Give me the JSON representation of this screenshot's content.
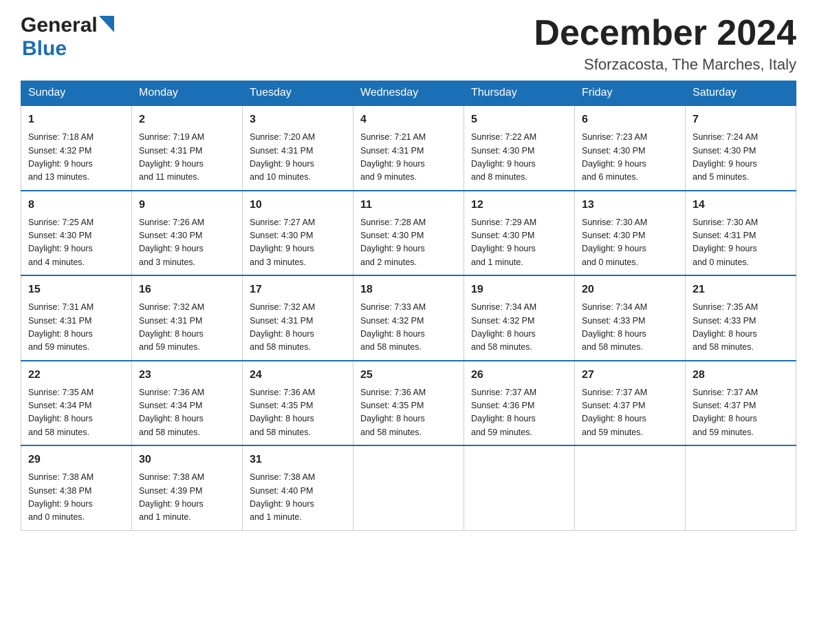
{
  "header": {
    "logo_general": "General",
    "logo_blue": "Blue",
    "month_title": "December 2024",
    "location": "Sforzacosta, The Marches, Italy"
  },
  "days_of_week": [
    "Sunday",
    "Monday",
    "Tuesday",
    "Wednesday",
    "Thursday",
    "Friday",
    "Saturday"
  ],
  "weeks": [
    [
      {
        "day": "1",
        "sunrise": "7:18 AM",
        "sunset": "4:32 PM",
        "daylight": "9 hours and 13 minutes."
      },
      {
        "day": "2",
        "sunrise": "7:19 AM",
        "sunset": "4:31 PM",
        "daylight": "9 hours and 11 minutes."
      },
      {
        "day": "3",
        "sunrise": "7:20 AM",
        "sunset": "4:31 PM",
        "daylight": "9 hours and 10 minutes."
      },
      {
        "day": "4",
        "sunrise": "7:21 AM",
        "sunset": "4:31 PM",
        "daylight": "9 hours and 9 minutes."
      },
      {
        "day": "5",
        "sunrise": "7:22 AM",
        "sunset": "4:30 PM",
        "daylight": "9 hours and 8 minutes."
      },
      {
        "day": "6",
        "sunrise": "7:23 AM",
        "sunset": "4:30 PM",
        "daylight": "9 hours and 6 minutes."
      },
      {
        "day": "7",
        "sunrise": "7:24 AM",
        "sunset": "4:30 PM",
        "daylight": "9 hours and 5 minutes."
      }
    ],
    [
      {
        "day": "8",
        "sunrise": "7:25 AM",
        "sunset": "4:30 PM",
        "daylight": "9 hours and 4 minutes."
      },
      {
        "day": "9",
        "sunrise": "7:26 AM",
        "sunset": "4:30 PM",
        "daylight": "9 hours and 3 minutes."
      },
      {
        "day": "10",
        "sunrise": "7:27 AM",
        "sunset": "4:30 PM",
        "daylight": "9 hours and 3 minutes."
      },
      {
        "day": "11",
        "sunrise": "7:28 AM",
        "sunset": "4:30 PM",
        "daylight": "9 hours and 2 minutes."
      },
      {
        "day": "12",
        "sunrise": "7:29 AM",
        "sunset": "4:30 PM",
        "daylight": "9 hours and 1 minute."
      },
      {
        "day": "13",
        "sunrise": "7:30 AM",
        "sunset": "4:30 PM",
        "daylight": "9 hours and 0 minutes."
      },
      {
        "day": "14",
        "sunrise": "7:30 AM",
        "sunset": "4:31 PM",
        "daylight": "9 hours and 0 minutes."
      }
    ],
    [
      {
        "day": "15",
        "sunrise": "7:31 AM",
        "sunset": "4:31 PM",
        "daylight": "8 hours and 59 minutes."
      },
      {
        "day": "16",
        "sunrise": "7:32 AM",
        "sunset": "4:31 PM",
        "daylight": "8 hours and 59 minutes."
      },
      {
        "day": "17",
        "sunrise": "7:32 AM",
        "sunset": "4:31 PM",
        "daylight": "8 hours and 58 minutes."
      },
      {
        "day": "18",
        "sunrise": "7:33 AM",
        "sunset": "4:32 PM",
        "daylight": "8 hours and 58 minutes."
      },
      {
        "day": "19",
        "sunrise": "7:34 AM",
        "sunset": "4:32 PM",
        "daylight": "8 hours and 58 minutes."
      },
      {
        "day": "20",
        "sunrise": "7:34 AM",
        "sunset": "4:33 PM",
        "daylight": "8 hours and 58 minutes."
      },
      {
        "day": "21",
        "sunrise": "7:35 AM",
        "sunset": "4:33 PM",
        "daylight": "8 hours and 58 minutes."
      }
    ],
    [
      {
        "day": "22",
        "sunrise": "7:35 AM",
        "sunset": "4:34 PM",
        "daylight": "8 hours and 58 minutes."
      },
      {
        "day": "23",
        "sunrise": "7:36 AM",
        "sunset": "4:34 PM",
        "daylight": "8 hours and 58 minutes."
      },
      {
        "day": "24",
        "sunrise": "7:36 AM",
        "sunset": "4:35 PM",
        "daylight": "8 hours and 58 minutes."
      },
      {
        "day": "25",
        "sunrise": "7:36 AM",
        "sunset": "4:35 PM",
        "daylight": "8 hours and 58 minutes."
      },
      {
        "day": "26",
        "sunrise": "7:37 AM",
        "sunset": "4:36 PM",
        "daylight": "8 hours and 59 minutes."
      },
      {
        "day": "27",
        "sunrise": "7:37 AM",
        "sunset": "4:37 PM",
        "daylight": "8 hours and 59 minutes."
      },
      {
        "day": "28",
        "sunrise": "7:37 AM",
        "sunset": "4:37 PM",
        "daylight": "8 hours and 59 minutes."
      }
    ],
    [
      {
        "day": "29",
        "sunrise": "7:38 AM",
        "sunset": "4:38 PM",
        "daylight": "9 hours and 0 minutes."
      },
      {
        "day": "30",
        "sunrise": "7:38 AM",
        "sunset": "4:39 PM",
        "daylight": "9 hours and 1 minute."
      },
      {
        "day": "31",
        "sunrise": "7:38 AM",
        "sunset": "4:40 PM",
        "daylight": "9 hours and 1 minute."
      },
      null,
      null,
      null,
      null
    ]
  ],
  "labels": {
    "sunrise_prefix": "Sunrise: ",
    "sunset_prefix": "Sunset: ",
    "daylight_prefix": "Daylight: "
  }
}
